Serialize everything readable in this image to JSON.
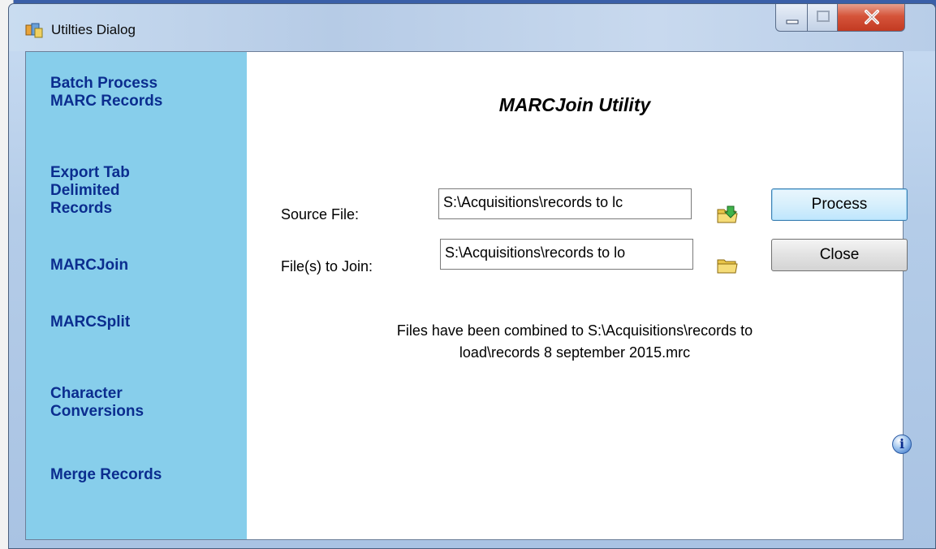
{
  "window": {
    "title": "Utilties Dialog",
    "controls": {
      "minimize": "minimize-icon",
      "maximize": "maximize-icon",
      "close": "close-icon"
    }
  },
  "sidebar": {
    "items": [
      {
        "label": "Batch Process\nMARC Records"
      },
      {
        "label": "Export Tab\nDelimited\nRecords"
      },
      {
        "label": "MARCJoin"
      },
      {
        "label": "MARCSplit"
      },
      {
        "label": "Character\nConversions"
      },
      {
        "label": "Merge Records"
      }
    ]
  },
  "main": {
    "title": "MARCJoin Utility",
    "source_file": {
      "label": "Source File:",
      "value": "S:\\Acquisitions\\records to lc"
    },
    "join_files": {
      "label": "File(s) to Join:",
      "value": "S:\\Acquisitions\\records to lo"
    },
    "buttons": {
      "process": "Process",
      "close": "Close"
    },
    "status_line1": "Files have been combined to S:\\Acquisitions\\records to",
    "status_line2": "load\\records 8 september 2015.mrc",
    "info_glyph": "i"
  },
  "colors": {
    "sidebar_bg": "#87ceeb",
    "nav_text": "#0b2d8f",
    "desktop": "#3a5fa8"
  }
}
